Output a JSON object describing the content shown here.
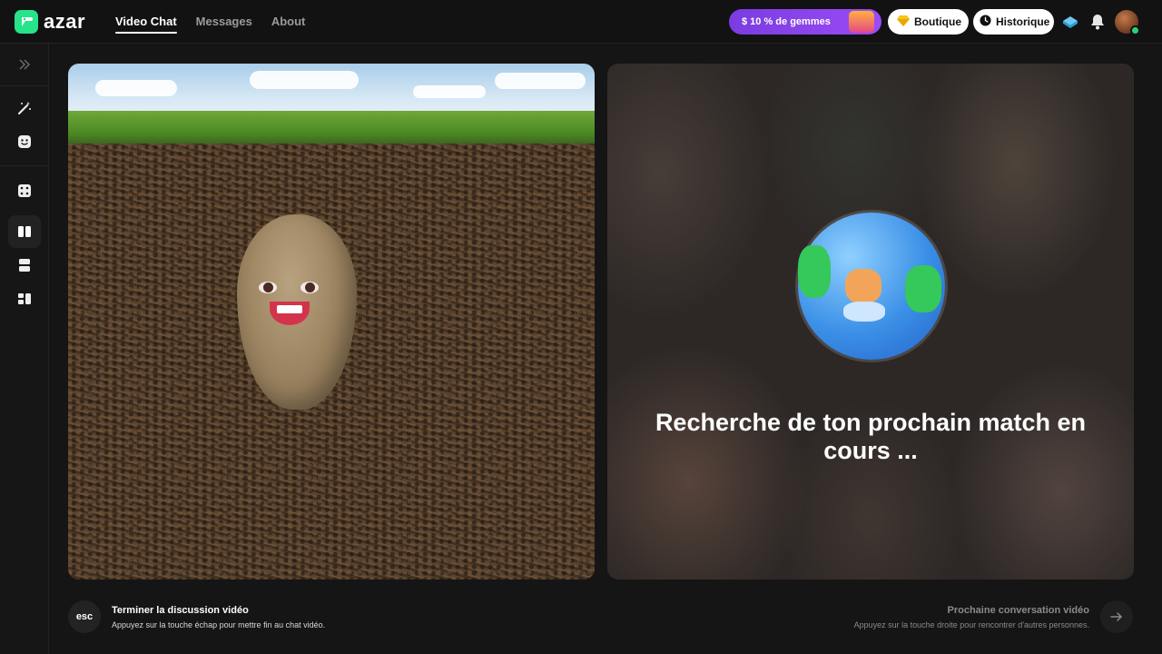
{
  "app": {
    "name": "azar"
  },
  "nav": [
    {
      "label": "Video Chat",
      "active": true
    },
    {
      "label": "Messages",
      "active": false
    },
    {
      "label": "About",
      "active": false
    }
  ],
  "header": {
    "promo_label": "$ 10 % de gemmes",
    "boutique_label": "Boutique",
    "historique_label": "Historique",
    "icons": [
      "gem-icon",
      "clock-icon",
      "gem-stack-icon",
      "bell-icon",
      "avatar"
    ]
  },
  "sidebar": {
    "items": [
      {
        "icon": "expand-chevrons-icon"
      },
      {
        "icon": "magic-wand-icon"
      },
      {
        "icon": "face-filter-icon"
      },
      {
        "icon": "dice-icon"
      },
      {
        "icon": "layout-side-by-side-icon",
        "selected": true
      },
      {
        "icon": "layout-stacked-icon"
      },
      {
        "icon": "layout-grid-icon"
      }
    ]
  },
  "main": {
    "search_status": "Recherche de ton prochain match en cours ..."
  },
  "footer": {
    "esc_key": "esc",
    "end_title": "Terminer la discussion vidéo",
    "end_sub": "Appuyez sur la touche échap pour mettre fin au chat vidéo.",
    "next_title": "Prochaine conversation vidéo",
    "next_sub": "Appuyez sur la touche droite pour rencontrer d'autres personnes."
  },
  "colors": {
    "brand_green": "#27e38a",
    "promo_purple": "#8a44ec",
    "background": "#151515"
  }
}
